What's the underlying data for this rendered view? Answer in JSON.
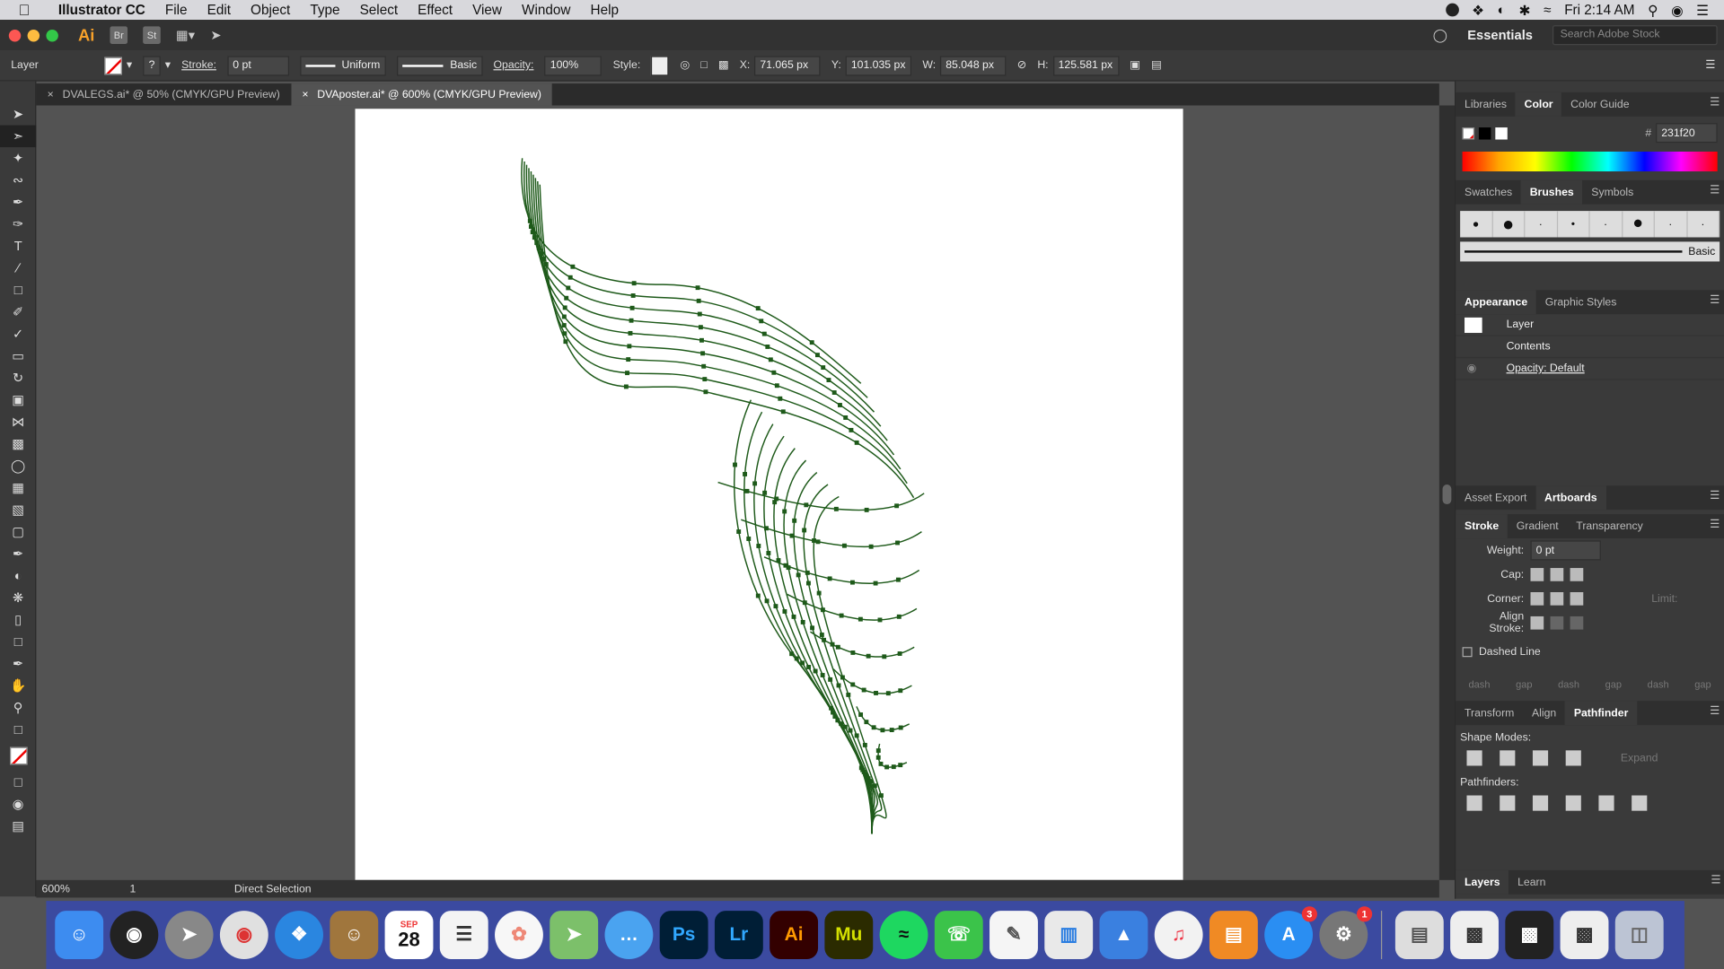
{
  "menubar": {
    "app": "Illustrator CC",
    "items": [
      "File",
      "Edit",
      "Object",
      "Type",
      "Select",
      "Effect",
      "View",
      "Window",
      "Help"
    ],
    "clock": "Fri 2:14 AM"
  },
  "appbar": {
    "logo": "Ai",
    "br": "Br",
    "st": "St",
    "workspace": "Essentials",
    "search_placeholder": "Search Adobe Stock"
  },
  "control": {
    "selection": "Layer",
    "stroke_label": "Stroke:",
    "stroke_value": "0 pt",
    "profile": "Uniform",
    "brush": "Basic",
    "opacity_label": "Opacity:",
    "opacity_value": "100%",
    "style_label": "Style:",
    "x_label": "X:",
    "x_value": "71.065 px",
    "y_label": "Y:",
    "y_value": "101.035 px",
    "w_label": "W:",
    "w_value": "85.048 px",
    "h_label": "H:",
    "h_value": "125.581 px"
  },
  "tabs": [
    {
      "label": "DVALEGS.ai* @ 50% (CMYK/GPU Preview)"
    },
    {
      "label": "DVAposter.ai* @ 600% (CMYK/GPU Preview)"
    }
  ],
  "status": {
    "zoom": "600%",
    "page": "1",
    "tool": "Direct Selection"
  },
  "panels": {
    "top_tabs": [
      "Libraries",
      "Color",
      "Color Guide"
    ],
    "hex": "231f20",
    "brush_tabs": [
      "Swatches",
      "Brushes",
      "Symbols"
    ],
    "brush_basic": "Basic",
    "appearance_tabs": [
      "Appearance",
      "Graphic Styles"
    ],
    "appearance_rows": [
      "Layer",
      "Contents",
      "Opacity: Default"
    ],
    "artboard_tabs": [
      "Asset Export",
      "Artboards"
    ],
    "stroke_tabs": [
      "Stroke",
      "Gradient",
      "Transparency"
    ],
    "weight_label": "Weight:",
    "weight_value": "0 pt",
    "cap_label": "Cap:",
    "corner_label": "Corner:",
    "limit_label": "Limit:",
    "align_label": "Align Stroke:",
    "dashed": "Dashed Line",
    "dash_labels": [
      "dash",
      "gap",
      "dash",
      "gap",
      "dash",
      "gap"
    ],
    "pf_tabs": [
      "Transform",
      "Align",
      "Pathfinder"
    ],
    "shape_modes": "Shape Modes:",
    "expand": "Expand",
    "pathfinders": "Pathfinders:",
    "layers_tabs": [
      "Layers",
      "Learn"
    ]
  },
  "dock": {
    "calendar_month": "SEP",
    "calendar_day": "28",
    "apps": [
      "Ps",
      "Lr",
      "Ai",
      "Mu"
    ],
    "badge_appstore": "3",
    "badge_settings": "1"
  },
  "colors": {
    "path": "#1e5a1a",
    "accent_ai": "#f7a12a"
  }
}
